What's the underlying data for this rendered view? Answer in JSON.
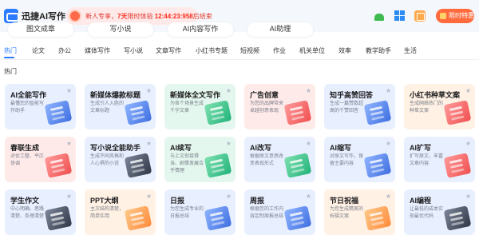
{
  "app": {
    "title": "迅捷AI写作"
  },
  "promo": {
    "prefix": "新人专享，",
    "highlight": "7天",
    "middle": "限时体验 ",
    "countdown": "12:44:23:958",
    "suffix": "后结束"
  },
  "header": {
    "cta_label": "限时特惠"
  },
  "mode_tabs": [
    "图文成章",
    "写小说",
    "AI内容写作",
    "AI助理"
  ],
  "categories": [
    "热门",
    "论文",
    "办公",
    "媒体写作",
    "写小说",
    "文章写作",
    "小红书专题",
    "短视频",
    "作业",
    "机关单位",
    "效率",
    "教学助手",
    "生活"
  ],
  "active_category": "热门",
  "section_title": "热门",
  "cards": [
    {
      "title": "AI全能写作",
      "desc": "最懂您的智能写作助手",
      "theme": "blue"
    },
    {
      "title": "新媒体爆款标题",
      "desc": "生成引人入胜的文章标题",
      "theme": "blue"
    },
    {
      "title": "新媒体全文写作",
      "desc": "为各个场景生成千字文章",
      "theme": "green"
    },
    {
      "title": "广告创意",
      "desc": "为您的品牌带来卓越创意表现",
      "theme": "red"
    },
    {
      "title": "知乎高赞回答",
      "desc": "生成一篇赞数超高的千赞回答",
      "theme": "blue"
    },
    {
      "title": "小红书种草文案",
      "desc": "生成网络热门的种草文案",
      "theme": "orange"
    },
    {
      "title": "春联生成",
      "desc": "对仗工整、平仄协调",
      "theme": "red"
    },
    {
      "title": "写小说全能助手",
      "desc": "生成不同风格和人心俱的小说",
      "theme": "blue"
    },
    {
      "title": "AI续写",
      "desc": "与上文衔接得当、剧情发展合乎情理",
      "theme": "green"
    },
    {
      "title": "AI改写",
      "desc": "根据原文意思改变表现形式",
      "theme": "blue"
    },
    {
      "title": "AI缩写",
      "desc": "对原文写作，保留主要内容",
      "theme": "blue"
    },
    {
      "title": "AI扩写",
      "desc": "扩写原文，丰富文章内容",
      "theme": "blue"
    },
    {
      "title": "学生作文",
      "desc": "中心明确、思路清楚、条理清楚",
      "theme": "blue"
    },
    {
      "title": "PPT大纲",
      "desc": "主次结构清楚，简单实用",
      "theme": "orange"
    },
    {
      "title": "日报",
      "desc": "为您生成专业的日报总结",
      "theme": "blue"
    },
    {
      "title": "周报",
      "desc": "根据您的工作内容定制周报总结",
      "theme": "blue"
    },
    {
      "title": "节日祝福",
      "desc": "为您生成精美的祝福文案",
      "theme": "orange"
    },
    {
      "title": "AI编程",
      "desc": "让最低的成本实现最优代码",
      "theme": "blue"
    }
  ]
}
